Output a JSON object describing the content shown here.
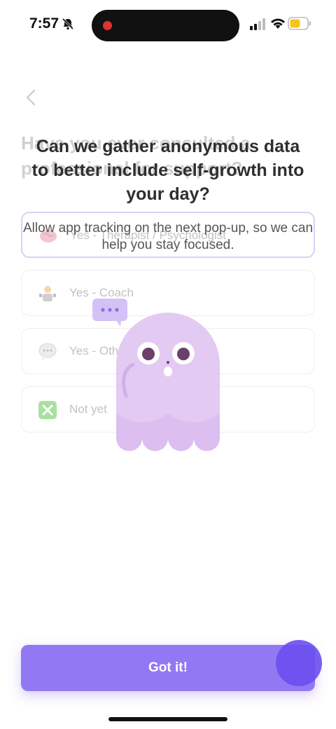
{
  "status": {
    "time": "7:57"
  },
  "background_question": {
    "line1": "Have you ever consulted a",
    "line2": "professional for support?"
  },
  "options": [
    {
      "label": "Yes - Therapist / Psychologist",
      "icon": "brain-icon"
    },
    {
      "label": "Yes - Coach",
      "icon": "coach-icon"
    },
    {
      "label": "Yes - Other",
      "icon": "speech-bubble-icon"
    },
    {
      "label": "Not yet",
      "icon": "cross-mark-icon"
    }
  ],
  "overlay": {
    "title_line1": "Can we gather anonymous data",
    "title_line2": "to better include self-growth into",
    "title_line3": "your day?",
    "subtitle": "Allow app tracking on the next pop-up, so we can help you stay focused."
  },
  "cta": {
    "label": "Got it!"
  },
  "colors": {
    "accent": "#9378f3",
    "ghost": "#e2cbf4",
    "tap": "#6a4ff0"
  }
}
